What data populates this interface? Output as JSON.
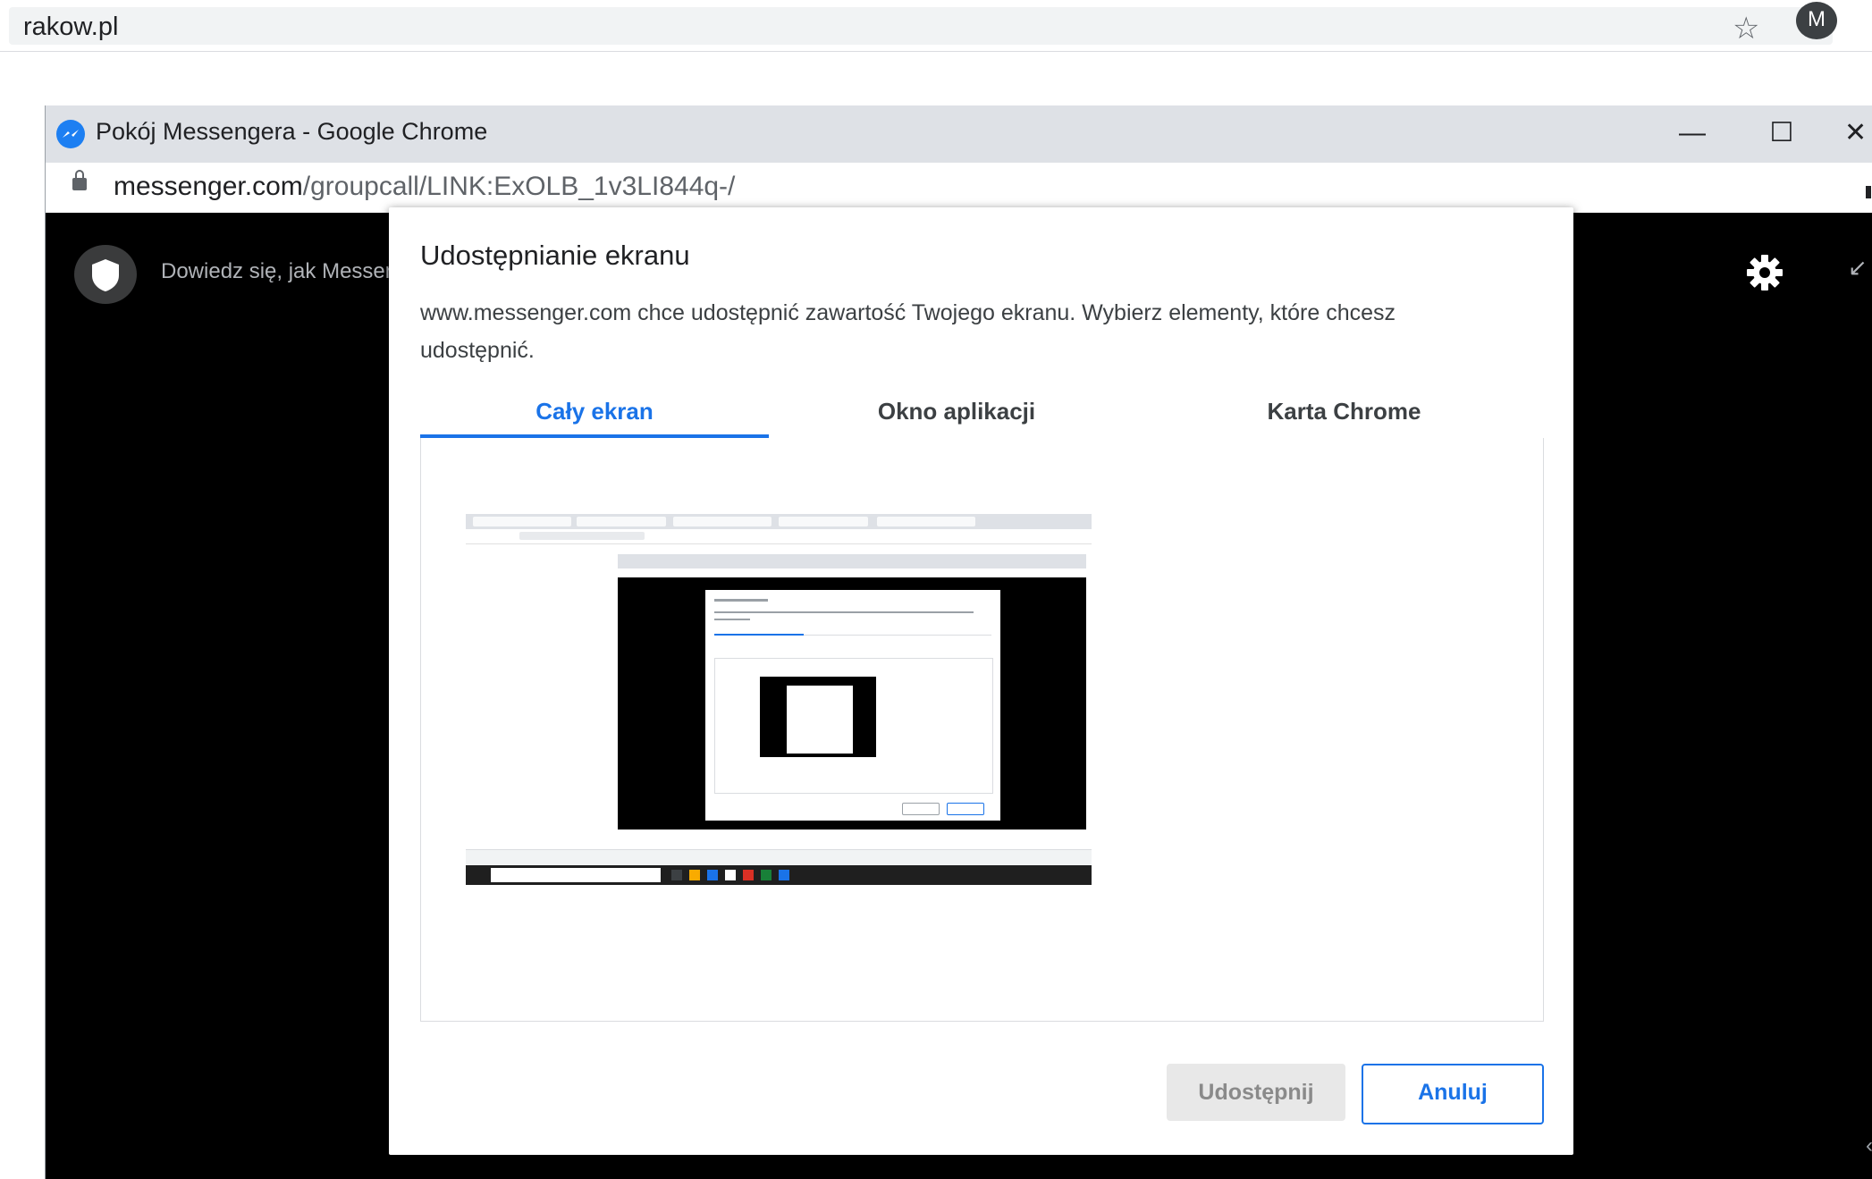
{
  "browser": {
    "url": "rakow.pl",
    "avatar_letter": "M"
  },
  "popup": {
    "window_title": "Pokój Messengera - Google Chrome",
    "url_domain": "messenger.com",
    "url_path": "/groupcall/LINK:ExOLB_1v3LI844q-/",
    "minimize": "—",
    "maximize": "☐",
    "close": "✕"
  },
  "messenger": {
    "learn_text": "Dowiedz się, jak Messen"
  },
  "dialog": {
    "title": "Udostępnianie ekranu",
    "description": "www.messenger.com chce udostępnić zawartość Twojego ekranu. Wybierz elementy, które chcesz udostępnić.",
    "tabs": [
      {
        "label": "Cały ekran",
        "active": true
      },
      {
        "label": "Okno aplikacji",
        "active": false
      },
      {
        "label": "Karta Chrome",
        "active": false
      }
    ],
    "share_button": "Udostępnij",
    "cancel_button": "Anuluj"
  },
  "colors": {
    "accent": "#1a73e8",
    "messenger_blue": "#1d7ff2",
    "dark_bg": "#000000"
  }
}
